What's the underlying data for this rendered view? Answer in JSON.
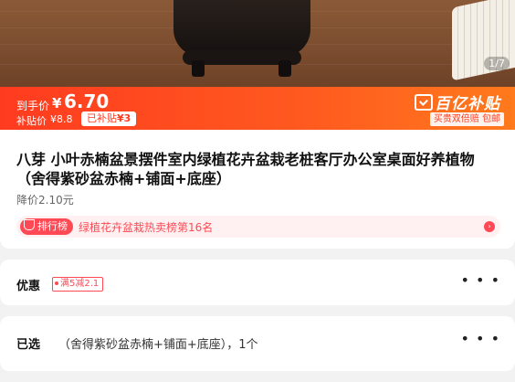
{
  "hero": {
    "image_counter": "1/7"
  },
  "price_bar": {
    "final_label": "到手价",
    "currency": "¥",
    "final_price": "6.70",
    "subsidy_label": "补贴价",
    "subsidy_price": "¥8.8",
    "subsidy_tag_prefix": "已补贴",
    "subsidy_tag_value": "¥3",
    "brand": "百亿补贴",
    "guarantee": "买贵双倍赔 包邮",
    "accent_color": "#ff3b1f"
  },
  "product": {
    "title": "八芽 小叶赤楠盆景摆件室内绿植花卉盆栽老桩客厅办公室桌面好养植物（舍得紫砂盆赤楠+铺面+底座）",
    "price_drop": "降价2.10元",
    "rank_badge": "排行榜",
    "rank_text": "绿植花卉盆栽热卖榜第16名"
  },
  "discount": {
    "label": "优惠",
    "coupon": "满5减2.1",
    "more": "• • •"
  },
  "selection": {
    "label": "已选",
    "value": "（舍得紫砂盆赤楠+铺面+底座），1个",
    "more": "• • •"
  }
}
